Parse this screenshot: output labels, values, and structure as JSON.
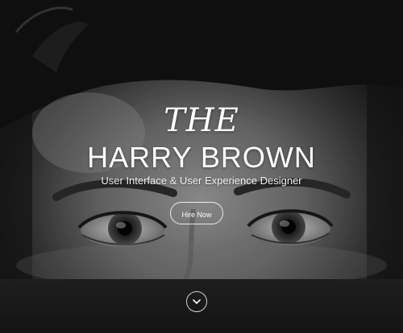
{
  "hero": {
    "prefix": "THE",
    "name": "HARRY BROWN",
    "tagline": "User Interface & User Experience Designer",
    "hire_button_label": "Hire Now",
    "scroll_icon": "chevron-down-icon"
  },
  "colors": {
    "text": "#ffffff",
    "button_border": "#ffffff",
    "band": "#1a1a1a"
  }
}
